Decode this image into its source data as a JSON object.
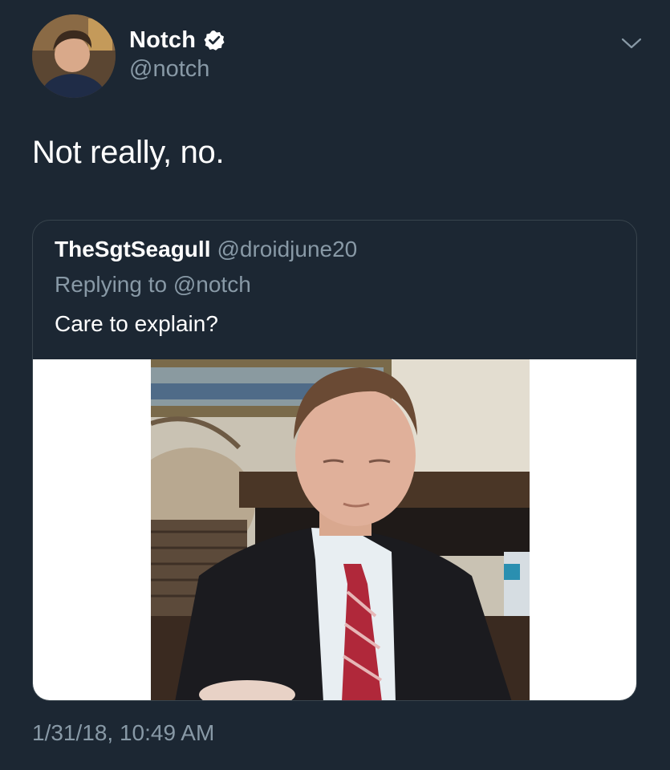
{
  "author": {
    "display_name": "Notch",
    "handle": "@notch",
    "verified": true
  },
  "tweet": {
    "text": "Not really, no.",
    "timestamp": "1/31/18, 10:49 AM"
  },
  "quoted_tweet": {
    "display_name": "TheSgtSeagull",
    "handle": "@droidjune20",
    "replying_to": "Replying to @notch",
    "text": "Care to explain?",
    "has_media": true
  },
  "icons": {
    "verified": "verified-badge-icon",
    "menu": "chevron-down-icon"
  },
  "colors": {
    "background": "#1c2733",
    "text_primary": "#ffffff",
    "text_secondary": "#8899a6",
    "border": "#38444d"
  }
}
